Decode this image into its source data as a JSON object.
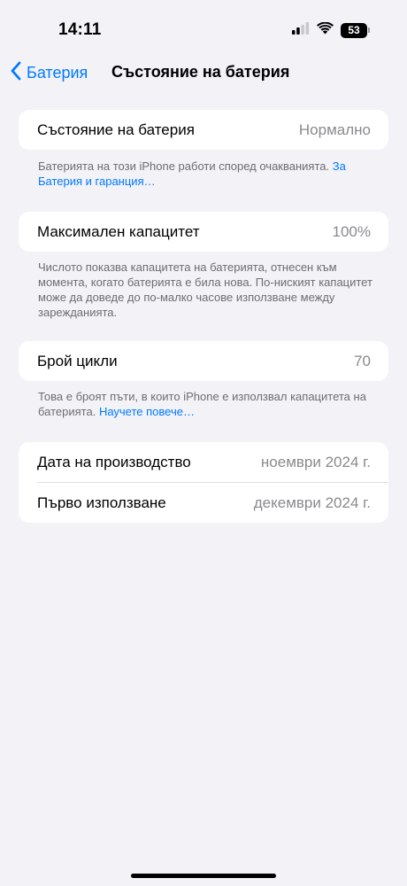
{
  "status": {
    "time": "14:11",
    "battery_level": "53"
  },
  "nav": {
    "back_label": "Батерия",
    "title": "Състояние на батерия"
  },
  "battery_health": {
    "label": "Състояние на батерия",
    "value": "Нормално",
    "note": "Батерията на този iPhone работи според очакванията. ",
    "note_link": "За Батерия и гаранция…"
  },
  "max_capacity": {
    "label": "Максимален капацитет",
    "value": "100%",
    "note": "Числото показва капацитета на батерията, отнесен към момента, когато батерията е била нова. По-ниският капацитет може да доведе до по-малко часове използване между зарежданията."
  },
  "cycle_count": {
    "label": "Брой цикли",
    "value": "70",
    "note": "Това е броят пъти, в които iPhone е използвал капацитета на батерията. ",
    "note_link": "Научете повече…"
  },
  "dates": {
    "manufacture_label": "Дата на производство",
    "manufacture_value": "ноември 2024 г.",
    "first_use_label": "Първо използване",
    "first_use_value": "декември 2024 г."
  },
  "colors": {
    "accent": "#007aff",
    "background": "#f2f2f7",
    "secondary_text": "#8a8a8e"
  }
}
